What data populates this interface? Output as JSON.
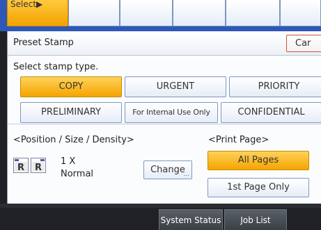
{
  "top_bar": {
    "select_label": "Select▶"
  },
  "header": {
    "title": "Preset Stamp",
    "cancel_label": "Car"
  },
  "stamp_types": {
    "label": "Select stamp type.",
    "options": [
      "COPY",
      "URGENT",
      "PRIORITY",
      "PRELIMINARY",
      "For Internal Use Only",
      "CONFIDENTIAL"
    ],
    "selected": "COPY"
  },
  "position": {
    "label": "<Position / Size / Density>",
    "size_value": "1 X",
    "density_value": "Normal",
    "change_label": "Change",
    "change_suffix": "..."
  },
  "print_page": {
    "label": "<Print Page>",
    "options": [
      "All Pages",
      "1st Page Only"
    ],
    "selected": "All Pages"
  },
  "bottom_bar": {
    "system_status_label": "System Status",
    "job_list_label": "Job List"
  },
  "colors": {
    "selected": "#f5a400",
    "tab_blue": "#2f57b5",
    "cancel_border": "#d94e2b"
  },
  "icons": [
    "stamp-position-icon",
    "stamp-position-icon-2"
  ]
}
